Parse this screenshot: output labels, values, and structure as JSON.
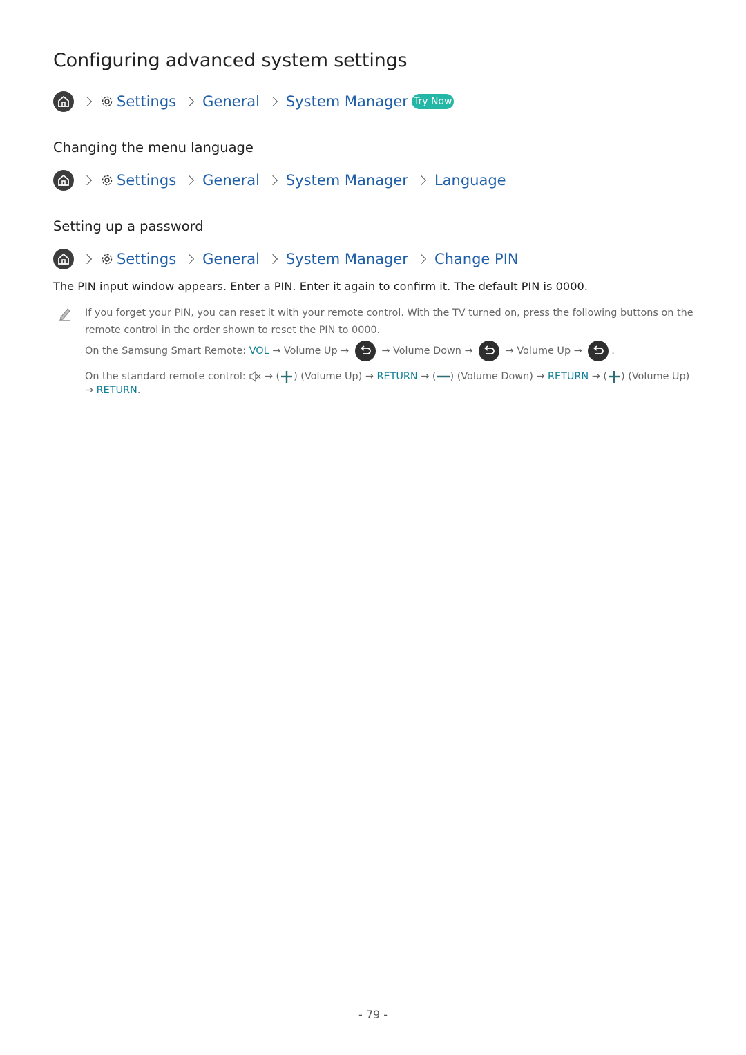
{
  "page": {
    "title": "Configuring advanced system settings",
    "page_number": "- 79 -"
  },
  "breadcrumb_main": {
    "items": [
      "Settings",
      "General",
      "System Manager"
    ],
    "try_now": "Try Now"
  },
  "section_language": {
    "heading": "Changing the menu language",
    "breadcrumb": [
      "Settings",
      "General",
      "System Manager",
      "Language"
    ]
  },
  "section_password": {
    "heading": "Setting up a password",
    "breadcrumb": [
      "Settings",
      "General",
      "System Manager",
      "Change PIN"
    ],
    "body": "The PIN input window appears. Enter a PIN. Enter it again to confirm it. The default PIN is 0000.",
    "note": {
      "line1": "If you forget your PIN, you can reset it with your remote control. With the TV turned on, press the following buttons on the",
      "line2": "remote control in the order shown to reset the PIN to 0000.",
      "smart_remote": {
        "prefix": "On the Samsung Smart Remote: ",
        "vol": "VOL",
        "step1": " → Volume Up → ",
        "step2": " → Volume Down → ",
        "step3": " → Volume Up → ",
        "end": "."
      },
      "standard_remote": {
        "prefix": "On the standard remote control: ",
        "arrow1": " → (",
        "vol_up": ") (Volume Up) → ",
        "return1": "RETURN",
        "arrow2": " → (",
        "vol_down": ") (Volume Down) → ",
        "return2": "RETURN",
        "arrow3": " → (",
        "vol_up2": ") (Volume Up)",
        "line2_arrow": "→ ",
        "return3": "RETURN",
        "line2_end": "."
      }
    }
  },
  "colors": {
    "link_blue": "#1f5ea8",
    "teal": "#0f7f95",
    "try_now_bg": "#25b7a6"
  }
}
